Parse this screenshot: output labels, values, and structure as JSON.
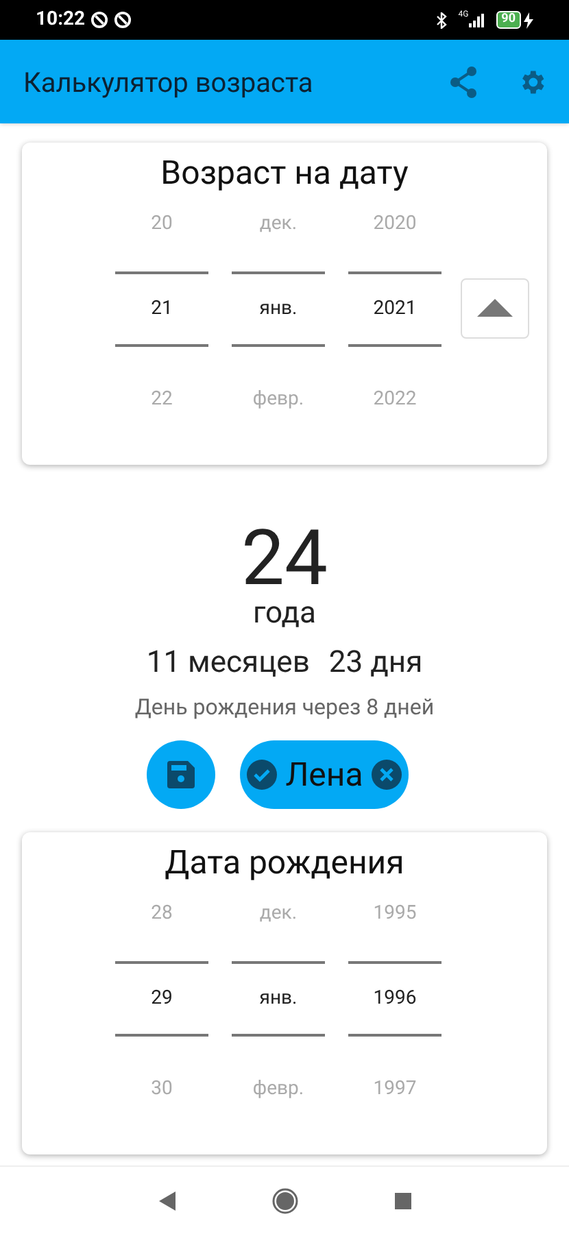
{
  "status_bar": {
    "time": "10:22",
    "network": "4G",
    "battery": "90"
  },
  "app_bar": {
    "title": "Калькулятор возраста"
  },
  "target_date": {
    "title": "Возраст на дату",
    "toggle_button": true,
    "columns": [
      {
        "prev": "20",
        "current": "21",
        "next": "22"
      },
      {
        "prev": "дек.",
        "current": "янв.",
        "next": "февр."
      },
      {
        "prev": "2020",
        "current": "2021",
        "next": "2022"
      }
    ]
  },
  "age": {
    "years": "24",
    "years_unit": "года",
    "months": "11",
    "months_unit": "месяцев",
    "days": "23",
    "days_unit": "дня",
    "note": "День рождения через 8 дней"
  },
  "profile_chip": {
    "label": "Лена",
    "selected": true
  },
  "birth_date": {
    "title": "Дата рождения",
    "toggle_button": false,
    "columns": [
      {
        "prev": "28",
        "current": "29",
        "next": "30"
      },
      {
        "prev": "дек.",
        "current": "янв.",
        "next": "февр."
      },
      {
        "prev": "1995",
        "current": "1996",
        "next": "1997"
      }
    ]
  }
}
